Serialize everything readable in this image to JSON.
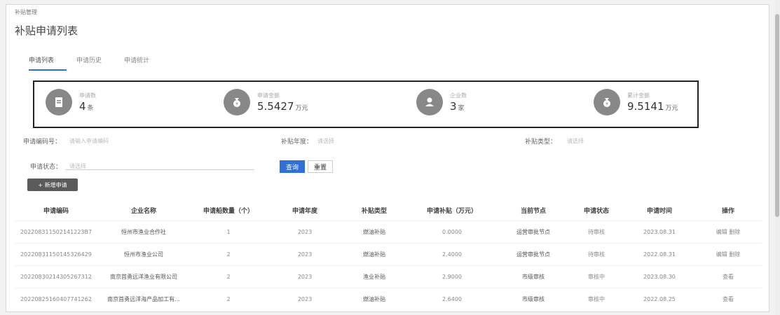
{
  "breadcrumb": "补贴管理",
  "page_title": "补贴申请列表",
  "tabs": [
    {
      "label": "申请列表",
      "active": true
    },
    {
      "label": "申请历史",
      "active": false
    },
    {
      "label": "申请统计",
      "active": false
    }
  ],
  "stats": [
    {
      "label": "申请数",
      "value": "4",
      "unit": "条",
      "icon": "document-icon"
    },
    {
      "label": "申请金额",
      "value": "5.5427",
      "unit": "万元",
      "icon": "money-bag-icon"
    },
    {
      "label": "企业数",
      "value": "3",
      "unit": "家",
      "icon": "person-icon"
    },
    {
      "label": "累计金额",
      "value": "9.5141",
      "unit": "万元",
      "icon": "money-bag-icon"
    }
  ],
  "filters": {
    "code_label": "申请编码号：",
    "code_placeholder": "请输入申请编码",
    "year_label": "补贴年度：",
    "year_placeholder": "请选择",
    "type_label": "补贴类型：",
    "type_placeholder": "请选择",
    "status_label": "申请状态：",
    "status_placeholder": "请选择"
  },
  "buttons": {
    "query": "查询",
    "reset": "重置",
    "add": "+ 新增申请"
  },
  "table": {
    "headers": [
      "申请编码",
      "企业名称",
      "申请船数量（个）",
      "申请年度",
      "补贴类型",
      "申请补贴（万元）",
      "当前节点",
      "申请状态",
      "申请时间",
      "操作"
    ],
    "rows": [
      [
        "202208311502141223B7",
        "恒州市渔业合作社",
        "1",
        "2023",
        "燃油补贴",
        "0.0000",
        "运营审批节点",
        "待审核",
        "2023.08.31",
        "编辑 删除"
      ],
      [
        "20220831150145326429",
        "恒州市渔业公司",
        "2",
        "2023",
        "燃油补贴",
        "2.4000",
        "运营审批节点",
        "待审核",
        "2022.08.31",
        "编辑 删除"
      ],
      [
        "20220830214305267312",
        "南京首勇远洋渔业有限公司",
        "2",
        "2023",
        "渔业补贴",
        "2.9000",
        "市级审核",
        "审核中",
        "2023.08.30",
        "查看"
      ],
      [
        "20220825160407741262",
        "南京首勇远洋海产品加工有...",
        "2",
        "2023",
        "燃油补贴",
        "2.6400",
        "市级审核",
        "审核中",
        "2022.08.25",
        "查看"
      ]
    ]
  },
  "colors": {
    "accent": "#2f6fd6",
    "stat_icon_bg": "#888888",
    "border": "#222222"
  }
}
